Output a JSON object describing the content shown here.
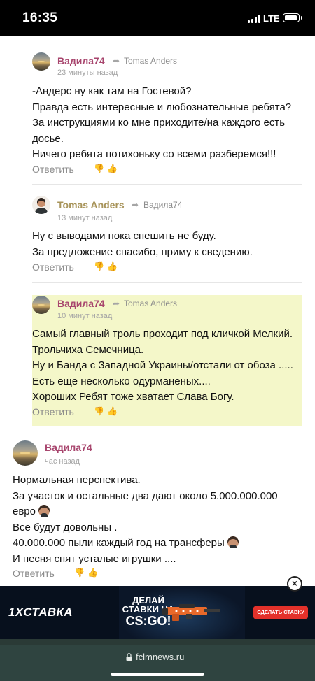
{
  "status_bar": {
    "time": "16:35",
    "network": "LTE"
  },
  "comments": [
    {
      "author": "Вадила74",
      "reply_to": "Tomas Anders",
      "time": "23 минуты назад",
      "lines": [
        "-Андерс ну как там на Гостевой?",
        "Правда есть интересные и любознательные ребята?",
        "За инструкциями ко мне приходите/на каждого есть",
        "досье.",
        "Ничего ребята потихоньку со всеми разберемся!!!"
      ],
      "answer": "Ответить"
    },
    {
      "author": "Tomas Anders",
      "reply_to": "Вадила74",
      "time": "13 минут назад",
      "lines": [
        "Ну с выводами пока спешить не буду.",
        "За предложение спасибо, приму к сведению."
      ],
      "answer": "Ответить"
    },
    {
      "author": "Вадила74",
      "reply_to": "Tomas Anders",
      "time": "10 минут назад",
      "lines": [
        "Самый главный троль проходит под кличкой Мелкий.",
        "Трольчиха Семечница.",
        "Ну и Банда с Западной Украины/отстали от обоза .....",
        "Есть еще несколько одурманеных....",
        "Хороших Ребят тоже хватает Слава Богу."
      ],
      "answer": "Ответить",
      "highlighted": true
    },
    {
      "author": "Вадила74",
      "time": "час назад",
      "lines": [
        "Нормальная перспектива.",
        "За участок и остальные два дают около 5.000.000.000",
        "евро",
        "Все будут довольны .",
        "40.000.000 пыли каждый год на трансферы",
        "И песня спят усталые игрушки ...."
      ],
      "answer": "Ответить"
    }
  ],
  "ad": {
    "brand": "1XСТАВКА",
    "headline_line1": "ДЕЛАЙ",
    "headline_line2": "СТАВКИ НА",
    "headline_line3": "CS:GO!",
    "cta": "СДЕЛАТЬ СТАВКУ",
    "close": "×"
  },
  "browser": {
    "url": "fclmnews.ru"
  },
  "colors": {
    "author_purple": "#a8466e",
    "author_olive": "#a8945a",
    "highlight": "#f4f7c9",
    "cta_red": "#e3312a"
  }
}
